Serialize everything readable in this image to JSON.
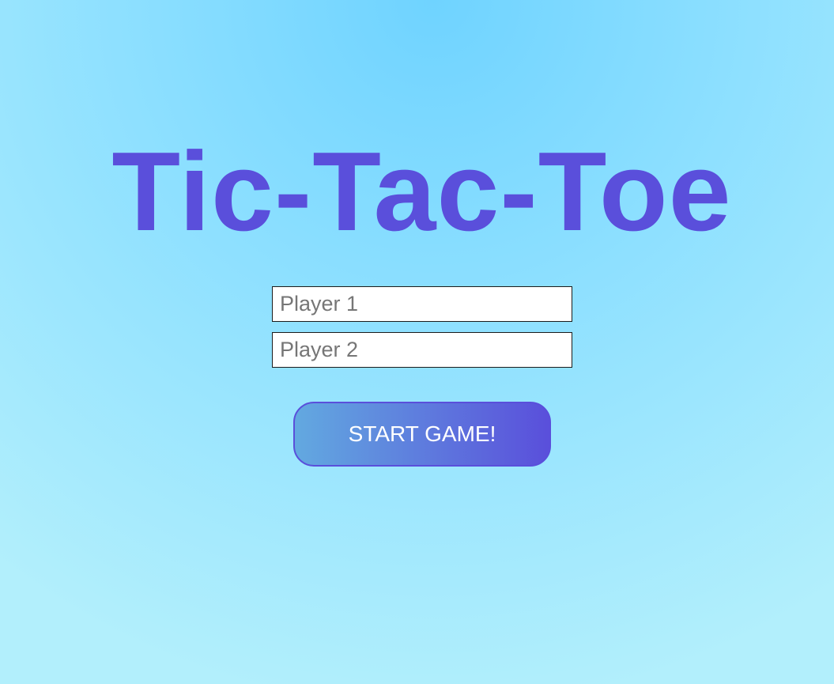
{
  "title": "Tic-Tac-Toe",
  "form": {
    "player1": {
      "value": "",
      "placeholder": "Player 1"
    },
    "player2": {
      "value": "",
      "placeholder": "Player 2"
    },
    "start_label": "START GAME!"
  },
  "colors": {
    "title": "#5a4fdb",
    "button_start": "#62a9e0",
    "button_end": "#5a4fdb",
    "background_top": "#6fd3ff",
    "background_bottom": "#b2effc"
  }
}
